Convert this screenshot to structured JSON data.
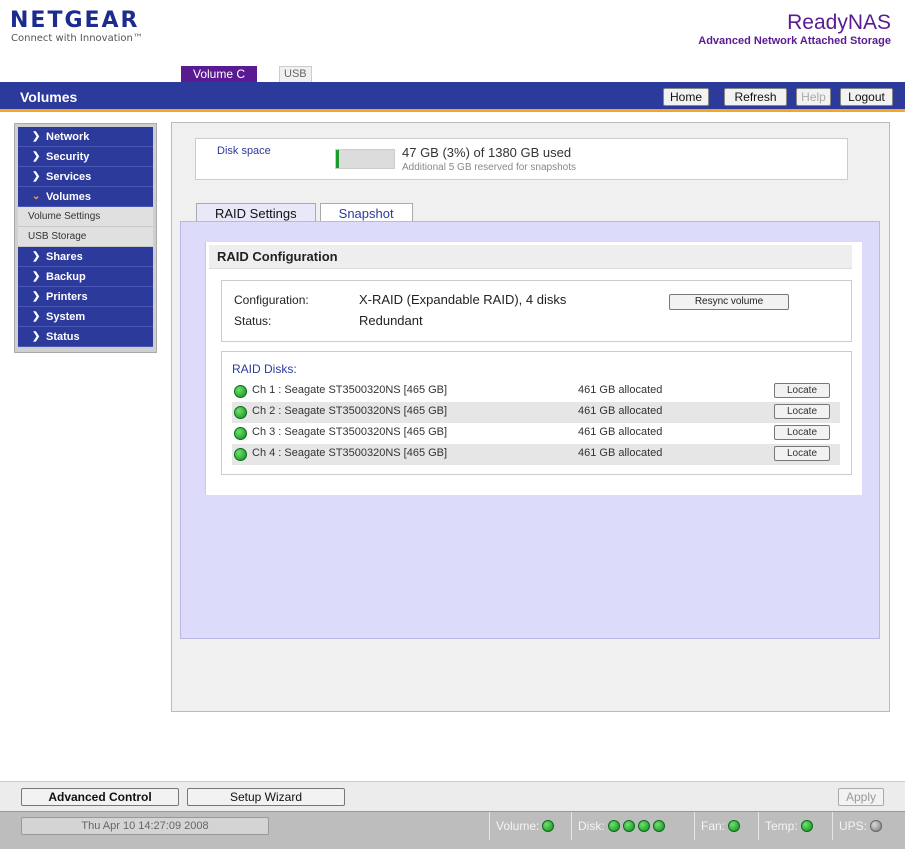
{
  "header": {
    "brand": "NETGEAR",
    "tagline": "Connect with Innovation™",
    "product": "ReadyNAS",
    "product_subtitle": "Advanced Network Attached Storage",
    "top_tabs": [
      "Volume C",
      "USB"
    ]
  },
  "titlebar": {
    "title": "Volumes",
    "buttons": [
      "Home",
      "Refresh",
      "Help",
      "Logout"
    ]
  },
  "sidebar": {
    "items": [
      {
        "label": "Network"
      },
      {
        "label": "Security"
      },
      {
        "label": "Services"
      },
      {
        "label": "Volumes"
      },
      {
        "label": "Volume Settings"
      },
      {
        "label": "USB Storage"
      },
      {
        "label": "Shares"
      },
      {
        "label": "Backup"
      },
      {
        "label": "Printers"
      },
      {
        "label": "System"
      },
      {
        "label": "Status"
      }
    ]
  },
  "disk_space": {
    "label": "Disk space",
    "used_fraction": 0.03,
    "summary": "47 GB (3%) of 1380 GB used",
    "note": "Additional 5 GB reserved for snapshots"
  },
  "tabs": [
    "RAID Settings",
    "Snapshot"
  ],
  "raid": {
    "heading": "RAID Configuration",
    "config_label": "Configuration:",
    "config_value": "X-RAID (Expandable RAID), 4 disks",
    "status_label": "Status:",
    "status_value": "Redundant",
    "resync_label": "Resync volume",
    "disks_title": "RAID Disks:",
    "locate_label": "Locate",
    "disks": [
      {
        "name": "Ch 1 : Seagate ST3500320NS [465 GB]",
        "allocated": "461 GB allocated"
      },
      {
        "name": "Ch 2 : Seagate ST3500320NS [465 GB]",
        "allocated": "461 GB allocated"
      },
      {
        "name": "Ch 3 : Seagate ST3500320NS [465 GB]",
        "allocated": "461 GB allocated"
      },
      {
        "name": "Ch 4 : Seagate ST3500320NS [465 GB]",
        "allocated": "461 GB allocated"
      }
    ]
  },
  "bottom": {
    "advanced_control": "Advanced Control",
    "setup_wizard": "Setup Wizard",
    "apply": "Apply"
  },
  "status": {
    "clock": "Thu Apr 10  14:27:09 2008",
    "volume": "Volume:",
    "disk": "Disk:",
    "fan": "Fan:",
    "temp": "Temp:",
    "ups": "UPS:"
  },
  "colors": {
    "brand_blue": "#2c3a9c",
    "accent_purple": "#5a1a91",
    "accent_orange": "#f5a623",
    "led_green": "#1a9c2a"
  }
}
